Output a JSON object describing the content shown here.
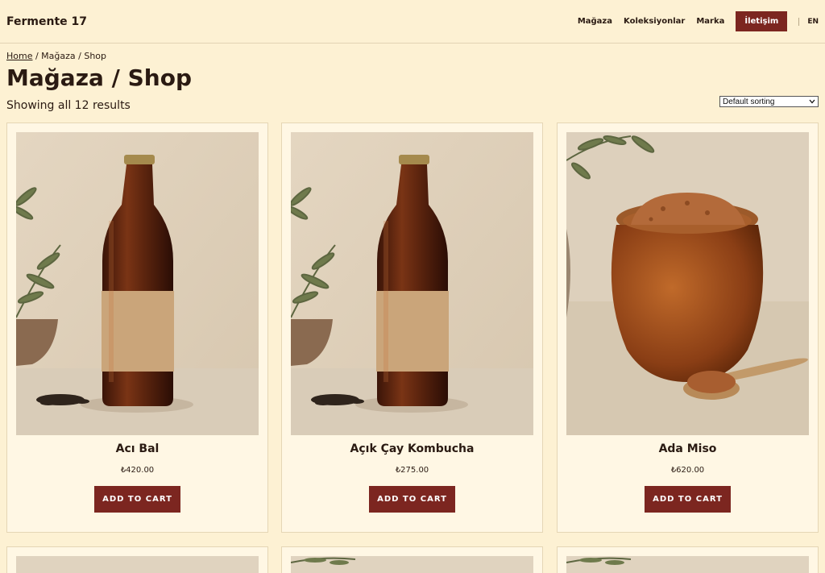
{
  "header": {
    "logo": "Fermente 17",
    "nav": [
      "Mağaza",
      "Koleksiyonlar",
      "Marka"
    ],
    "cta": "İletişim",
    "lang": "EN"
  },
  "breadcrumb": {
    "home": "Home",
    "rest": " / Mağaza / Shop"
  },
  "page_title": "Mağaza / Shop",
  "results": "Showing all 12 results",
  "sorting": {
    "selected": "Default sorting"
  },
  "products": [
    {
      "name": "Acı Bal",
      "price": "₺420.00",
      "button": "ADD TO CART"
    },
    {
      "name": "Açık Çay Kombucha",
      "price": "₺275.00",
      "button": "ADD TO CART"
    },
    {
      "name": "Ada Miso",
      "price": "₺620.00",
      "button": "ADD TO CART"
    }
  ],
  "colors": {
    "background": "#fdf1d3",
    "accent": "#7c2620",
    "card": "#fff7e4"
  }
}
